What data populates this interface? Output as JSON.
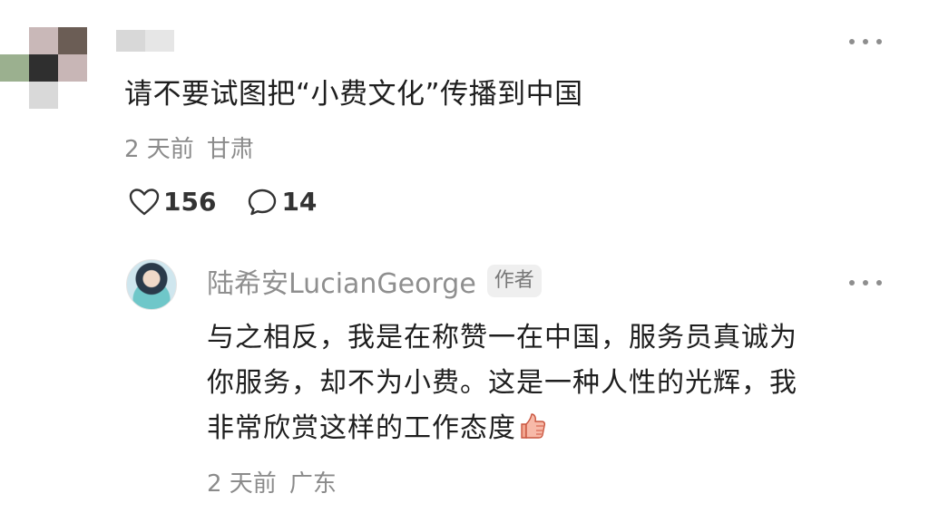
{
  "comment": {
    "text": "请不要试图把“小费文化”传播到中国",
    "time": "2 天前",
    "location": "甘肃",
    "likes": "156",
    "replies": "14"
  },
  "reply": {
    "author": "陆希安LucianGeorge",
    "badge": "作者",
    "text_lines": [
      "与之相反，我是在称赞一在中国，服务员真诚为",
      "你服务，却不为小费。这是一种人性的光辉，我",
      "非常欣赏这样的工作态度"
    ],
    "time": "2 天前",
    "location": "广东"
  },
  "icons": {
    "more": "more-dots-icon",
    "like": "heart-icon",
    "comment": "comment-bubble-icon",
    "emoji": "thumbs-up-emoji-icon"
  },
  "colors": {
    "text_primary": "#1e1e1e",
    "text_meta": "#8b8b8b",
    "badge_bg": "#efefef"
  }
}
